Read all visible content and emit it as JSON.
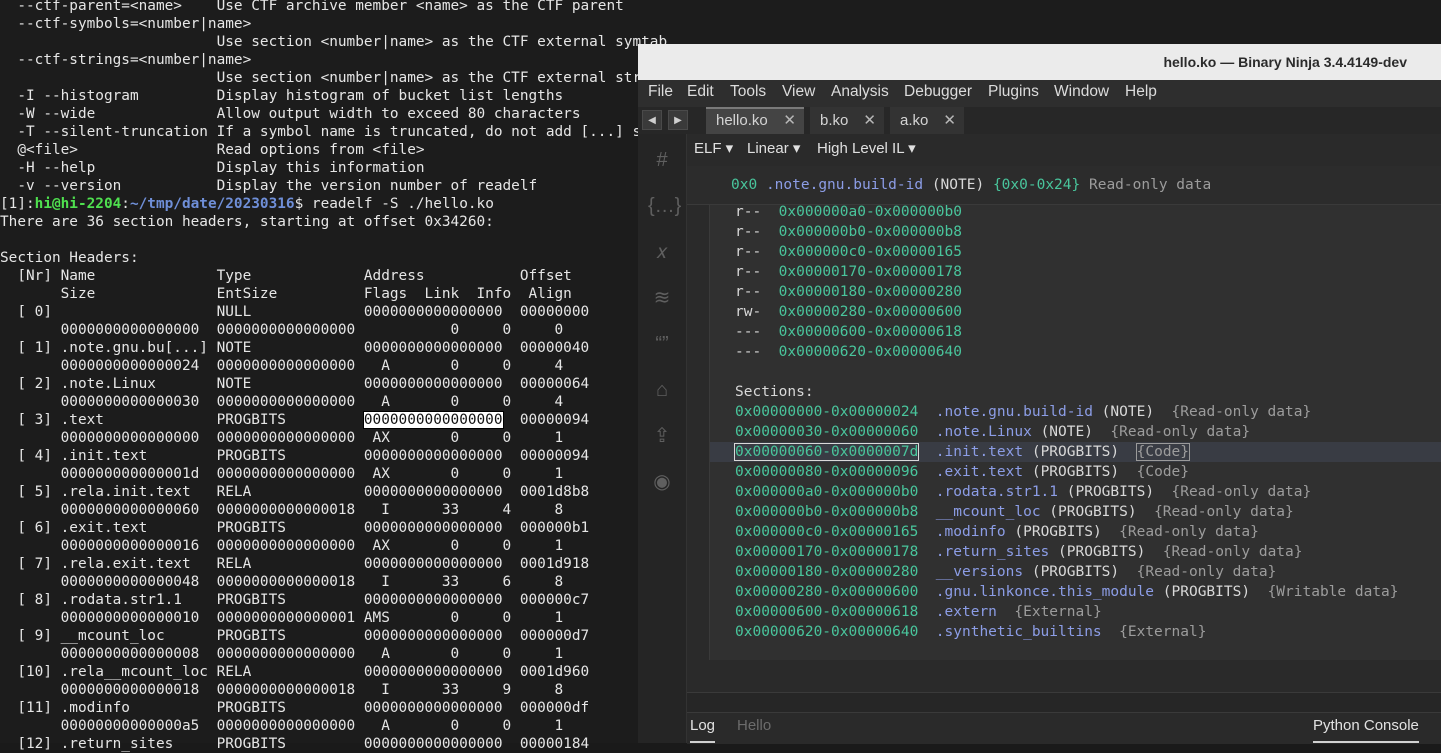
{
  "terminal": {
    "lines": [
      "  --ctf-parent=<name>    Use CTF archive member <name> as the CTF parent",
      "  --ctf-symbols=<number|name>",
      "                         Use section <number|name> as the CTF external symtab",
      "  --ctf-strings=<number|name>",
      "                         Use section <number|name> as the CTF external strtab",
      "  -I --histogram         Display histogram of bucket list lengths",
      "  -W --wide              Allow output width to exceed 80 characters",
      "  -T --silent-truncation If a symbol name is truncated, do not add [...] suffix",
      "  @<file>                Read options from <file>",
      "  -H --help              Display this information",
      "  -v --version           Display the version number of readelf"
    ],
    "prompt": {
      "prefix": "[1]:",
      "user": "hi@hi-2204",
      "colon": ":",
      "path": "~/tmp/date/20230316",
      "command": "$ readelf -S ./hello.ko"
    },
    "output_lines": [
      "There are 36 section headers, starting at offset 0x34260:",
      "",
      "Section Headers:",
      "  [Nr] Name              Type             Address           Offset",
      "       Size              EntSize          Flags  Link  Info  Align",
      "  [ 0]                   NULL             0000000000000000  00000000",
      "       0000000000000000  0000000000000000           0     0     0",
      "  [ 1] .note.gnu.bu[...] NOTE             0000000000000000  00000040",
      "       0000000000000024  0000000000000000   A       0     0     4",
      "  [ 2] .note.Linux       NOTE             0000000000000000  00000064",
      "       0000000000000030  0000000000000000   A       0     0     4"
    ],
    "highlight_line": {
      "before": "  [ 3] .text             PROGBITS         ",
      "selected": "0000000000000000",
      "after": "  00000094"
    },
    "rest_lines": [
      "       0000000000000000  0000000000000000  AX       0     0     1",
      "  [ 4] .init.text        PROGBITS         0000000000000000  00000094",
      "       000000000000001d  0000000000000000  AX       0     0     1",
      "  [ 5] .rela.init.text   RELA             0000000000000000  0001d8b8",
      "       0000000000000060  0000000000000018   I      33     4     8",
      "  [ 6] .exit.text        PROGBITS         0000000000000000  000000b1",
      "       0000000000000016  0000000000000000  AX       0     0     1",
      "  [ 7] .rela.exit.text   RELA             0000000000000000  0001d918",
      "       0000000000000048  0000000000000018   I      33     6     8",
      "  [ 8] .rodata.str1.1    PROGBITS         0000000000000000  000000c7",
      "       0000000000000010  0000000000000001 AMS       0     0     1",
      "  [ 9] __mcount_loc      PROGBITS         0000000000000000  000000d7",
      "       0000000000000008  0000000000000000   A       0     0     1",
      "  [10] .rela__mcount_loc RELA             0000000000000000  0001d960",
      "       0000000000000018  0000000000000018   I      33     9     8",
      "  [11] .modinfo          PROGBITS         0000000000000000  000000df",
      "       00000000000000a5  0000000000000000   A       0     0     1",
      "  [12] .return_sites     PROGBITS         0000000000000000  00000184"
    ]
  },
  "binja": {
    "title": "hello.ko — Binary Ninja 3.4.4149-dev",
    "menu": [
      "File",
      "Edit",
      "Tools",
      "View",
      "Analysis",
      "Debugger",
      "Plugins",
      "Window",
      "Help"
    ],
    "nav": {
      "back": "◀",
      "forward": "▶"
    },
    "tabs": [
      {
        "label": "hello.ko",
        "close": "✕"
      },
      {
        "label": "b.ko",
        "close": "✕"
      },
      {
        "label": "a.ko",
        "close": "✕"
      }
    ],
    "sidebar_icons": [
      "#",
      "{…}",
      "𝑥",
      "≋",
      "“”",
      "⌂",
      "⇪",
      "◉"
    ],
    "toolbar": {
      "format": "ELF ▾",
      "mode": "Linear ▾",
      "il": "High Level IL ▾"
    },
    "header": {
      "addr": "0x0",
      "name": ".note.gnu.build-id",
      "type": "(NOTE)",
      "range": "{0x0-0x24}",
      "desc": "Read-only data"
    },
    "segments": [
      {
        "perm": "r--",
        "range": "0x000000a0-0x000000b0"
      },
      {
        "perm": "r--",
        "range": "0x000000b0-0x000000b8"
      },
      {
        "perm": "r--",
        "range": "0x000000c0-0x00000165"
      },
      {
        "perm": "r--",
        "range": "0x00000170-0x00000178"
      },
      {
        "perm": "r--",
        "range": "0x00000180-0x00000280"
      },
      {
        "perm": "rw-",
        "range": "0x00000280-0x00000600"
      },
      {
        "perm": "---",
        "range": "0x00000600-0x00000618"
      },
      {
        "perm": "---",
        "range": "0x00000620-0x00000640"
      }
    ],
    "sections_label": "Sections:",
    "sections": [
      {
        "range": "0x00000000-0x00000024",
        "name": ".note.gnu.build-id",
        "type": "(NOTE)",
        "sem": "{Read-only data}"
      },
      {
        "range": "0x00000030-0x00000060",
        "name": ".note.Linux",
        "type": "(NOTE)",
        "sem": "{Read-only data}"
      },
      {
        "range": "0x00000060-0x0000007d",
        "name": ".init.text",
        "type": "(PROGBITS)",
        "sem": "{Code}"
      },
      {
        "range": "0x00000080-0x00000096",
        "name": ".exit.text",
        "type": "(PROGBITS)",
        "sem": "{Code}"
      },
      {
        "range": "0x000000a0-0x000000b0",
        "name": ".rodata.str1.1",
        "type": "(PROGBITS)",
        "sem": "{Read-only data}"
      },
      {
        "range": "0x000000b0-0x000000b8",
        "name": "__mcount_loc",
        "type": "(PROGBITS)",
        "sem": "{Read-only data}"
      },
      {
        "range": "0x000000c0-0x00000165",
        "name": ".modinfo",
        "type": "(PROGBITS)",
        "sem": "{Read-only data}"
      },
      {
        "range": "0x00000170-0x00000178",
        "name": ".return_sites",
        "type": "(PROGBITS)",
        "sem": "{Read-only data}"
      },
      {
        "range": "0x00000180-0x00000280",
        "name": "__versions",
        "type": "(PROGBITS)",
        "sem": "{Read-only data}"
      },
      {
        "range": "0x00000280-0x00000600",
        "name": ".gnu.linkonce.this_module",
        "type": "(PROGBITS)",
        "sem": "{Writable data}"
      },
      {
        "range": "0x00000600-0x00000618",
        "name": ".extern",
        "type": "",
        "sem": "{External}"
      },
      {
        "range": "0x00000620-0x00000640",
        "name": ".synthetic_builtins",
        "type": "",
        "sem": "{External}"
      }
    ],
    "bottom": {
      "log": "Log",
      "hello": "Hello",
      "python": "Python Console"
    },
    "colors": {
      "address": "#49c59c",
      "name": "#8c9de6",
      "accent": "#444444"
    }
  }
}
